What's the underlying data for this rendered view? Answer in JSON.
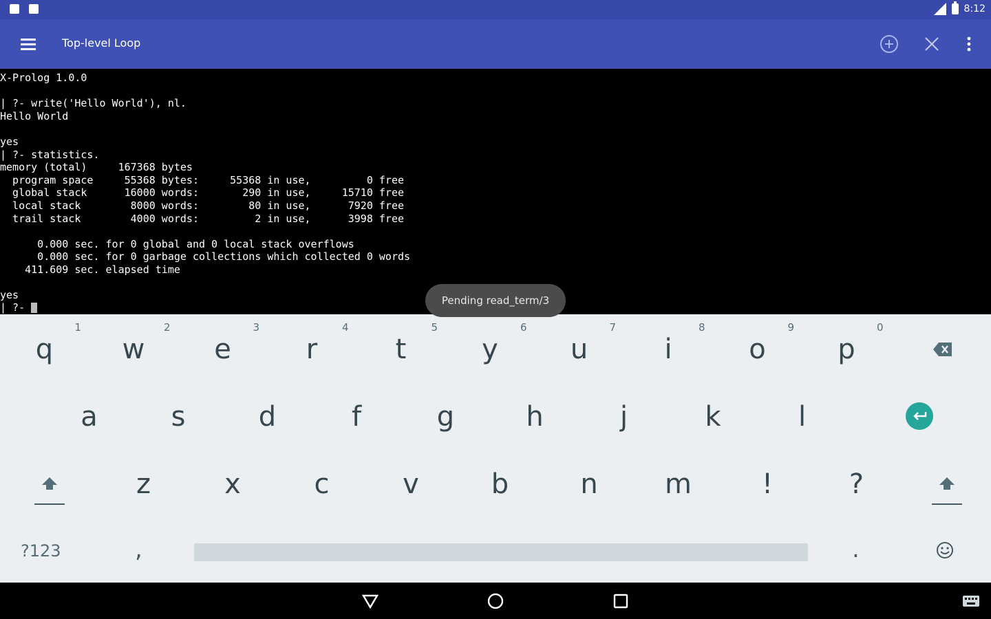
{
  "status_bar": {
    "time": "8:12"
  },
  "toolbar": {
    "title": "Top-level Loop"
  },
  "terminal": {
    "lines": [
      "X-Prolog 1.0.0",
      "",
      "| ?- write('Hello World'), nl.",
      "Hello World",
      "",
      "yes",
      "| ?- statistics.",
      "memory (total)     167368 bytes",
      "  program space     55368 bytes:     55368 in use,         0 free",
      "  global stack      16000 words:       290 in use,     15710 free",
      "  local stack        8000 words:        80 in use,      7920 free",
      "  trail stack        4000 words:         2 in use,      3998 free",
      "",
      "      0.000 sec. for 0 global and 0 local stack overflows",
      "      0.000 sec. for 0 garbage collections which collected 0 words",
      "    411.609 sec. elapsed time",
      "",
      "yes"
    ],
    "prompt": "| ?- "
  },
  "toast": {
    "text": "Pending read_term/3"
  },
  "keyboard": {
    "row1": [
      {
        "label": "q",
        "hint": "1"
      },
      {
        "label": "w",
        "hint": "2"
      },
      {
        "label": "e",
        "hint": "3"
      },
      {
        "label": "r",
        "hint": "4"
      },
      {
        "label": "t",
        "hint": "5"
      },
      {
        "label": "y",
        "hint": "6"
      },
      {
        "label": "u",
        "hint": "7"
      },
      {
        "label": "i",
        "hint": "8"
      },
      {
        "label": "o",
        "hint": "9"
      },
      {
        "label": "p",
        "hint": "0"
      }
    ],
    "row2": [
      "a",
      "s",
      "d",
      "f",
      "g",
      "h",
      "j",
      "k",
      "l"
    ],
    "row3": [
      "z",
      "x",
      "c",
      "v",
      "b",
      "n",
      "m",
      "!",
      "?"
    ],
    "symbols_label": "?123",
    "comma": ",",
    "period": "."
  }
}
